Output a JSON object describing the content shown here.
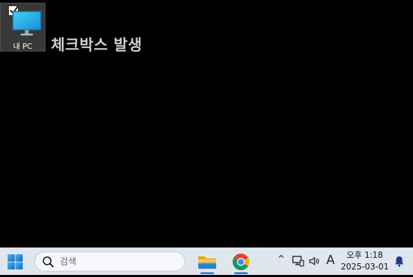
{
  "desktop": {
    "icons": [
      {
        "label": "내 PC",
        "icon": "monitor-icon",
        "checked": true
      }
    ],
    "annotation": "체크박스 발생"
  },
  "taskbar": {
    "start_icon": "windows-start-icon",
    "search": {
      "placeholder": "검색"
    },
    "apps": [
      {
        "name": "File Explorer",
        "icon": "folder-icon"
      },
      {
        "name": "Chrome",
        "icon": "chrome-icon"
      }
    ],
    "tray": {
      "chevron": "^",
      "ime": "A"
    },
    "clock": {
      "time": "오후 1:18",
      "date": "2025-03-01"
    }
  },
  "colors": {
    "desktop_bg": "#000000",
    "taskbar_bg": "#dfe6ee",
    "accent": "#3b82d6"
  }
}
